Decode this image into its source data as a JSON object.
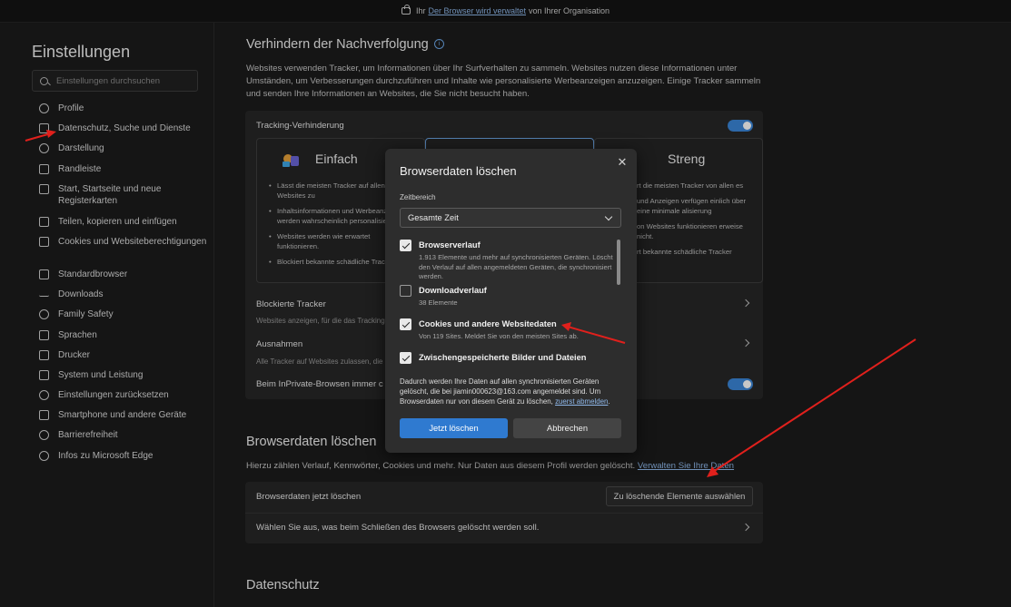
{
  "banner": {
    "prefix": "Ihr",
    "link": "Der Browser wird verwaltet",
    "suffix": "von Ihrer Organisation"
  },
  "sidebar": {
    "title": "Einstellungen",
    "search_placeholder": "Einstellungen durchsuchen",
    "items": [
      {
        "label": "Profile"
      },
      {
        "label": "Datenschutz, Suche und Dienste"
      },
      {
        "label": "Darstellung"
      },
      {
        "label": "Randleiste"
      },
      {
        "label": "Start, Startseite und neue Registerkarten"
      },
      {
        "label": "Teilen, kopieren und einfügen"
      },
      {
        "label": "Cookies und Websiteberechtigungen"
      },
      {
        "label": "Standardbrowser"
      },
      {
        "label": "Downloads"
      },
      {
        "label": "Family Safety"
      },
      {
        "label": "Sprachen"
      },
      {
        "label": "Drucker"
      },
      {
        "label": "System und Leistung"
      },
      {
        "label": "Einstellungen zurücksetzen"
      },
      {
        "label": "Smartphone und andere Geräte"
      },
      {
        "label": "Barrierefreiheit"
      },
      {
        "label": "Infos zu Microsoft Edge"
      }
    ]
  },
  "tracking": {
    "title": "Verhindern der Nachverfolgung",
    "description": "Websites verwenden Tracker, um Informationen über Ihr Surfverhalten zu sammeln. Websites nutzen diese Informationen unter Umständen, um Verbesserungen durchzuführen und Inhalte wie personalisierte Werbeanzeigen anzuzeigen. Einige Tracker sammeln und senden Ihre Informationen an Websites, die Sie nicht besucht haben.",
    "prevention_label": "Tracking-Verhinderung",
    "basic": {
      "title": "Einfach",
      "bullets": [
        "Lässt die meisten Tracker auf allen Websites zu",
        "Inhaltsinformationen und Werbeanzeigen werden wahrscheinlich personalisiert",
        "Websites werden wie erwartet funktionieren.",
        "Blockiert bekannte schädliche Tracker"
      ]
    },
    "strict": {
      "title": "Streng",
      "bullets": [
        "rt die meisten Tracker von allen es",
        "und Anzeigen verfügen einlich über eine minimale alisierung",
        "on Websites funktionieren erweise nicht.",
        "rt bekannte schädliche Tracker"
      ]
    },
    "blocked_title": "Blockierte Tracker",
    "blocked_sub": "Websites anzeigen, für die das Tracking",
    "exceptions_title": "Ausnahmen",
    "exceptions_sub": "Alle Tracker auf Websites zulassen, die",
    "inprivate_label": "Beim InPrivate-Browsen immer c"
  },
  "clear": {
    "title": "Browserdaten löschen",
    "description": "Hierzu zählen Verlauf, Kennwörter, Cookies und mehr. Nur Daten aus diesem Profil werden gelöscht.",
    "manage_link": "Verwalten Sie Ihre Daten",
    "now_label": "Browserdaten jetzt löschen",
    "choose_button": "Zu löschende Elemente auswählen",
    "on_close_label": "Wählen Sie aus, was beim Schließen des Browsers gelöscht werden soll."
  },
  "privacy": {
    "title": "Datenschutz"
  },
  "dialog": {
    "title": "Browserdaten löschen",
    "range_label": "Zeitbereich",
    "range_value": "Gesamte Zeit",
    "options": [
      {
        "label": "Browserverlauf",
        "sub": "1.913 Elemente und mehr auf synchronisierten Geräten. Löscht den Verlauf auf allen angemeldeten Geräten, die synchronisiert werden.",
        "checked": true
      },
      {
        "label": "Downloadverlauf",
        "sub": "38 Elemente",
        "checked": false
      },
      {
        "label": "Cookies und andere Websitedaten",
        "sub": "Von 119 Sites. Meldet Sie von den meisten Sites ab.",
        "checked": true
      },
      {
        "label": "Zwischengespeicherte Bilder und Dateien",
        "sub": "",
        "checked": true
      }
    ],
    "note": "Dadurch werden Ihre Daten auf allen synchronisierten Geräten gelöscht, die bei jiamin000623@163.com angemeldet sind. Um Browserdaten nur von diesem Gerät zu löschen,",
    "note_link": "zuerst abmelden",
    "note_end": ".",
    "primary_button": "Jetzt löschen",
    "cancel_button": "Abbrechen"
  },
  "colors": {
    "accent": "#2f7ad0",
    "annotation": "#e0201c"
  }
}
